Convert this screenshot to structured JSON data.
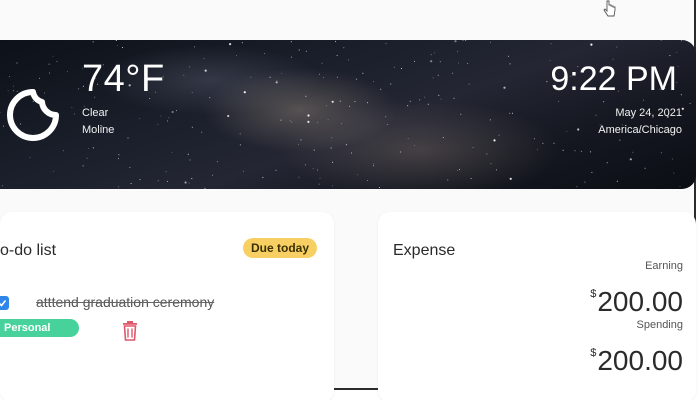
{
  "weather": {
    "temperature": "74°F",
    "condition": "Clear",
    "city": "Moline",
    "icon": "moon-icon"
  },
  "clock": {
    "time": "9:22 PM",
    "date": "May 24, 2021",
    "timezone": "America/Chicago"
  },
  "todo": {
    "title": "o-do list",
    "badge": "Due today",
    "items": [
      {
        "text": "atttend graduation ceremony",
        "done": true,
        "tag": "Personal"
      }
    ],
    "colors": {
      "badge": "#f7cf63",
      "tag": "#46d29a",
      "checkbox": "#2f86e8",
      "trash": "#e0566a"
    }
  },
  "expense": {
    "title": "Expense",
    "earning_label": "Earning",
    "earning_currency": "$",
    "earning_value": "200.00",
    "spending_label": "Spending",
    "spending_currency": "$",
    "spending_value": "200.00"
  }
}
